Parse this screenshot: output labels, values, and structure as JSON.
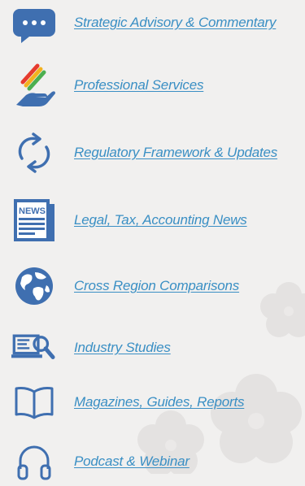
{
  "items": [
    {
      "label": "Strategic Advisory & Commentary",
      "icon": "chat-bubble-icon"
    },
    {
      "label": "Professional Services",
      "icon": "hand-pencil-icon"
    },
    {
      "label": "Regulatory Framework & Updates",
      "icon": "refresh-arrows-icon"
    },
    {
      "label": "Legal, Tax, Accounting News",
      "icon": "newspaper-icon"
    },
    {
      "label": "Cross Region Comparisons",
      "icon": "globe-icon"
    },
    {
      "label": "Industry Studies",
      "icon": "monitor-search-icon"
    },
    {
      "label": "Magazines, Guides, Reports",
      "icon": "open-book-icon"
    },
    {
      "label": "Podcast & Webinar",
      "icon": "headphones-icon"
    }
  ],
  "colors": {
    "link": "#3a8fc4",
    "icon": "#3f6fb0",
    "background": "#f1f0ef"
  }
}
